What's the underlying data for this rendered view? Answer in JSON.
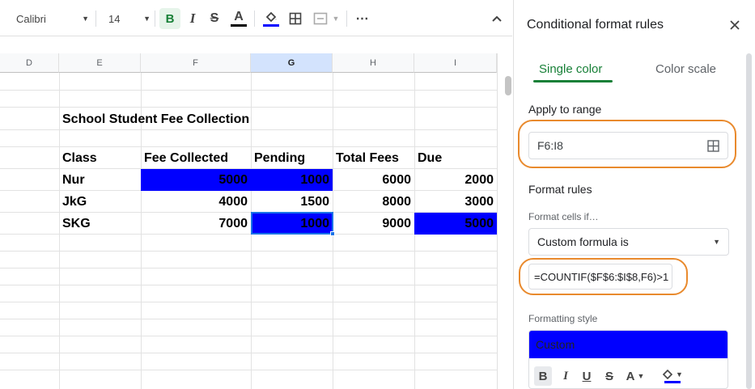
{
  "toolbar": {
    "font_name": "Calibri",
    "font_size": "14",
    "bold_label": "B",
    "italic_label": "I",
    "strike_label": "S",
    "text_color_label": "A",
    "more_label": "⋯"
  },
  "sheet": {
    "columns": [
      "D",
      "E",
      "F",
      "G",
      "H",
      "I"
    ],
    "selected_column": "G",
    "title": "School Student Fee Collection",
    "headers": [
      "Class",
      "Fee Collected",
      "Pending",
      "Total Fees",
      "Due"
    ],
    "rows": [
      {
        "class": "Nur",
        "fee_collected": "5000",
        "pending": "1000",
        "total_fees": "6000",
        "due": "2000"
      },
      {
        "class": "JkG",
        "fee_collected": "4000",
        "pending": "1500",
        "total_fees": "8000",
        "due": "3000"
      },
      {
        "class": "SKG",
        "fee_collected": "7000",
        "pending": "1000",
        "total_fees": "9000",
        "due": "5000"
      }
    ],
    "highlight_color": "#0000ff"
  },
  "panel": {
    "title": "Conditional format rules",
    "tabs": [
      "Single color",
      "Color scale"
    ],
    "active_tab": "Single color",
    "apply_to_range_label": "Apply to range",
    "range_value": "F6:I8",
    "format_rules_label": "Format rules",
    "format_cells_if_label": "Format cells if…",
    "condition_value": "Custom formula is",
    "formula_value": "=COUNTIF($F$6:$I$8,F6)>1",
    "formatting_style_label": "Formatting style",
    "style_preview_label": "Custom",
    "style_buttons": {
      "bold": "B",
      "italic": "I",
      "underline": "U",
      "strike": "S",
      "text_color": "A"
    },
    "accent_color": "#188038",
    "annotation_color": "#e98a2d"
  }
}
